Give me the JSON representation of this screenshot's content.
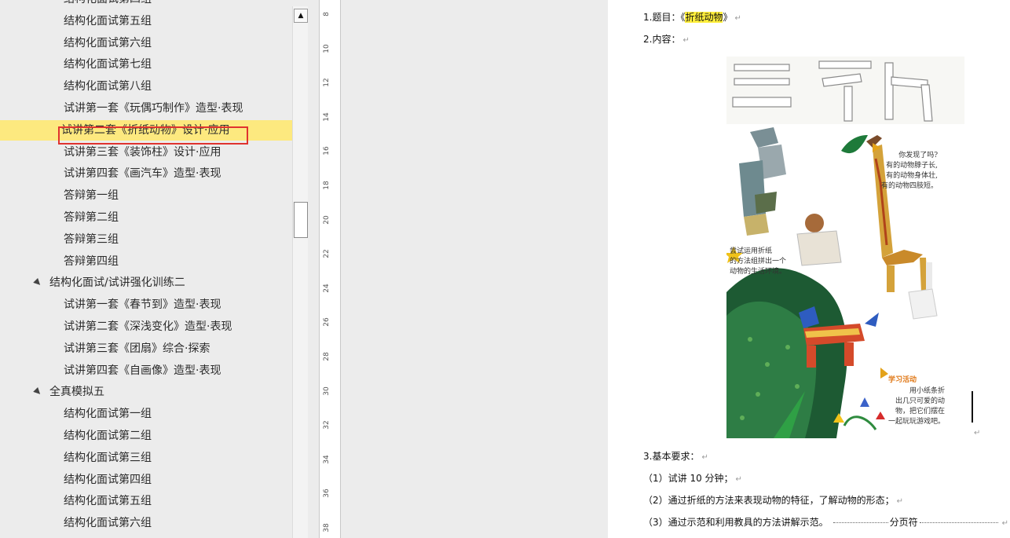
{
  "nav": {
    "items": [
      {
        "label": "结构化面试第四组",
        "level": 2
      },
      {
        "label": "结构化面试第五组",
        "level": 2
      },
      {
        "label": "结构化面试第六组",
        "level": 2
      },
      {
        "label": "结构化面试第七组",
        "level": 2
      },
      {
        "label": "结构化面试第八组",
        "level": 2
      },
      {
        "label": "试讲第一套《玩偶巧制作》造型·表现",
        "level": 2
      },
      {
        "label": "试讲第二套《折纸动物》设计·应用",
        "level": 2,
        "selected": true
      },
      {
        "label": "试讲第三套《装饰柱》设计·应用",
        "level": 2
      },
      {
        "label": "试讲第四套《画汽车》造型·表现",
        "level": 2
      },
      {
        "label": "答辩第一组",
        "level": 2
      },
      {
        "label": "答辩第二组",
        "level": 2
      },
      {
        "label": "答辩第三组",
        "level": 2
      },
      {
        "label": "答辩第四组",
        "level": 2
      },
      {
        "label": "结构化面试/试讲强化训练二",
        "level": 1,
        "expanded": true
      },
      {
        "label": "试讲第一套《春节到》造型·表现",
        "level": 2
      },
      {
        "label": "试讲第二套《深浅变化》造型·表现",
        "level": 2
      },
      {
        "label": "试讲第三套《团扇》综合·探索",
        "level": 2
      },
      {
        "label": "试讲第四套《自画像》造型·表现",
        "level": 2
      },
      {
        "label": "全真模拟五",
        "level": 1,
        "expanded": true
      },
      {
        "label": "结构化面试第一组",
        "level": 2
      },
      {
        "label": "结构化面试第二组",
        "level": 2
      },
      {
        "label": "结构化面试第三组",
        "level": 2
      },
      {
        "label": "结构化面试第四组",
        "level": 2
      },
      {
        "label": "结构化面试第五组",
        "level": 2
      },
      {
        "label": "结构化面试第六组",
        "level": 2
      }
    ],
    "expand_glyph": "▲",
    "scroll_up_glyph": "▲"
  },
  "ruler": {
    "ticks": [
      "8",
      "10",
      "12",
      "14",
      "16",
      "18",
      "20",
      "22",
      "24",
      "26",
      "28",
      "30",
      "32",
      "34",
      "36",
      "38"
    ]
  },
  "document": {
    "line1_prefix": "1.题目：《",
    "line1_title": "折纸动物",
    "line1_suffix": "》",
    "line2": "2.内容：",
    "line3": "3.基本要求：",
    "line4": "（1）试讲 10 分钟；",
    "line5": "（2）通过折纸的方法来表现动物的特征，了解动物的形态；",
    "line6": "（3）通过示范和利用教具的方法讲解示范。",
    "page_break": "分页符",
    "para_mark": "↵"
  },
  "figure": {
    "note1": "你发现了吗?\n有的动物脖子长,\n有的动物身体壮,\n有的动物四肢短。",
    "note2": "尝试运用折纸\n的方法组拼出一个\n动物的生活环境。",
    "activity_title": "学习活动",
    "activity_text": "用小纸条折\n出几只可爱的动\n物，把它们摆在\n一起玩玩游戏吧。",
    "colors": {
      "giraffe": "#d4a23a",
      "leaves": "#1d6b3a",
      "highlight": "#ffee3b",
      "selection_border": "#e0332f"
    }
  }
}
